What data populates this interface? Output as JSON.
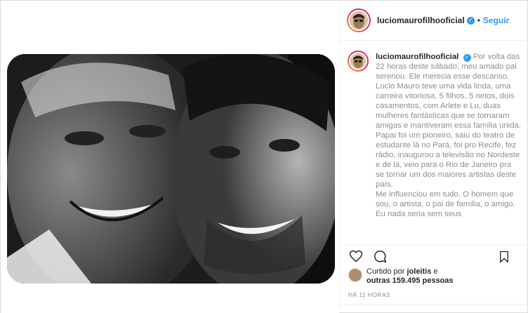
{
  "header": {
    "username": "luciomaurofilhooficial",
    "separator": "•",
    "follow_label": "Seguir",
    "verified_icon": "verified-icon"
  },
  "caption": {
    "username": "luciomaurofilhooficial",
    "lines": [
      "Por volta das 22 horas deste sábado, meu amado pai serenou. Ele merecia esse descanso.",
      "Lucio Mauro teve uma vida linda, uma carreira vitoriosa, 5 filhos, 5 netos, dois casamentos, com Arlete e Lu, duas mulheres fantásticas que se tornaram amigas e mantiveram essa família unida.",
      "Papai foi um pioneiro, saiu do teatro de estudante lá no Pará, foi pro Recife, fez rádio, inaugurou a televisão no Nordeste e de lá, veio para o Rio de Janeiro pra se tornar um dos maiores artistas deste país.",
      "Me influenciou em tudo. O homem que sou, o artista, o pai de família, o amigo. Eu nada seria sem seus"
    ]
  },
  "actions": {
    "like_icon": "heart-icon",
    "comment_icon": "comment-icon",
    "bookmark_icon": "bookmark-icon"
  },
  "likes": {
    "prefix": "Curtido por",
    "user": "joleitis",
    "middle": "e",
    "others": "outras 159.495 pessoas"
  },
  "timestamp": "HÁ 11 HORAS",
  "colors": {
    "accent": "#3897f0",
    "text": "#262626",
    "muted": "#8e8e8e",
    "border": "#efefef"
  }
}
